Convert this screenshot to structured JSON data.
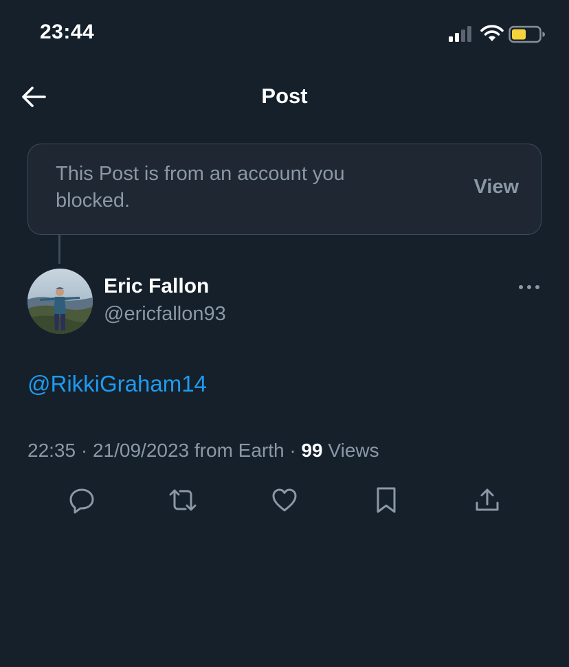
{
  "status_bar": {
    "time": "23:44",
    "icons": [
      "cellular-signal-icon",
      "wifi-icon",
      "battery-icon"
    ],
    "battery_color": "#f5d33c"
  },
  "header": {
    "title": "Post",
    "back_icon": "arrow-left-icon"
  },
  "blocked_notice": {
    "text": "This Post is from an account you blocked.",
    "view_label": "View"
  },
  "post": {
    "author": {
      "name": "Eric Fallon",
      "handle": "@ericfallon93",
      "avatar": "avatar-photo"
    },
    "more_icon": "more-options-icon",
    "text": "@RikkiGraham14",
    "meta": {
      "time": "22:35",
      "separator": "·",
      "date": "21/09/2023",
      "source": "from Earth",
      "views_count": "99",
      "views_label": "Views"
    },
    "actions": [
      {
        "name": "reply",
        "icon": "reply-icon"
      },
      {
        "name": "repost",
        "icon": "repost-icon"
      },
      {
        "name": "like",
        "icon": "heart-icon"
      },
      {
        "name": "bookmark",
        "icon": "bookmark-icon"
      },
      {
        "name": "share",
        "icon": "share-icon"
      }
    ]
  },
  "colors": {
    "background": "#15202b",
    "accent": "#1d9bf0",
    "secondary_text": "#8b98a5",
    "border": "#3e4c5a"
  }
}
